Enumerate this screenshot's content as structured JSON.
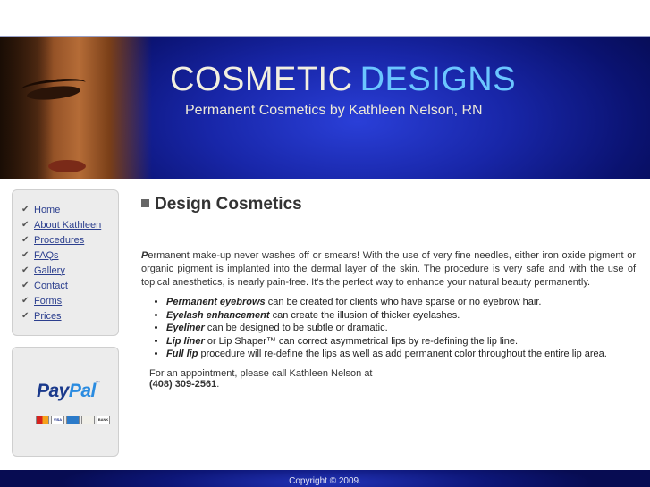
{
  "header": {
    "title_word_1": "COSMETIC",
    "title_word_2": "DESIGNS",
    "subtitle": "Permanent Cosmetics by Kathleen Nelson, RN"
  },
  "nav": {
    "items": [
      {
        "label": "Home"
      },
      {
        "label": "About Kathleen"
      },
      {
        "label": "Procedures"
      },
      {
        "label": "FAQs"
      },
      {
        "label": "Gallery"
      },
      {
        "label": "Contact"
      },
      {
        "label": "Forms"
      },
      {
        "label": "Prices"
      }
    ]
  },
  "paypal": {
    "logo_pay": "Pay",
    "logo_pal": "Pal",
    "trademark": "™",
    "cards": [
      "mastercard",
      "VISA",
      "amex",
      "discover",
      "BANK"
    ]
  },
  "main": {
    "heading": "Design Cosmetics",
    "intro_dropcap": "P",
    "intro_rest": "ermanent make-up never washes off or smears! With the use of very fine needles, either iron oxide pigment or organic pigment is implanted into the dermal layer of the skin. The procedure is very safe and with the use of topical anesthetics, is nearly pain-free. It's the perfect way to enhance your natural beauty permanently.",
    "features": [
      {
        "term": "Permanent eyebrows",
        "text": " can be created for clients who have sparse or no eyebrow hair."
      },
      {
        "term": "Eyelash enhancement",
        "text": " can create the illusion of thicker eyelashes."
      },
      {
        "term": "Eyeliner",
        "text": " can be designed to be subtle or dramatic."
      },
      {
        "term": "Lip liner",
        "text": " or Lip Shaper™ can correct asymmetrical lips by re-defining the lip line."
      },
      {
        "term": "Full lip",
        "text": " procedure will re-define the lips as well as add permanent color throughout the entire lip area."
      }
    ],
    "appointment_text": "For an appointment, please call Kathleen Nelson at",
    "phone": "(408) 309-2561",
    "phone_suffix": "."
  },
  "footer": {
    "copyright": "Copyright © 2009."
  },
  "colors": {
    "banner_blue": "#1826a8",
    "title_light": "#f2efe0",
    "title_accent": "#6bc6ff",
    "nav_link": "#2c3f8e",
    "sidebar_bg": "#ececec"
  },
  "icons": {
    "nav_bullet": "check-icon",
    "heading_bullet": "square-bullet-icon"
  }
}
